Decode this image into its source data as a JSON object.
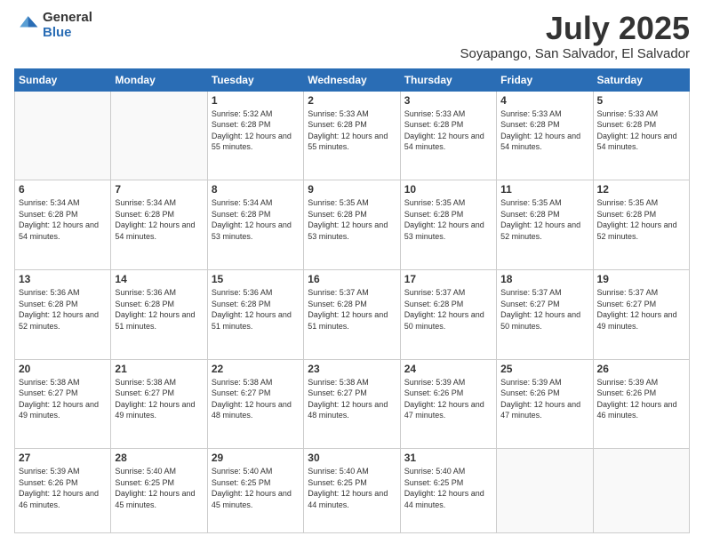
{
  "logo": {
    "general": "General",
    "blue": "Blue"
  },
  "header": {
    "month": "July 2025",
    "location": "Soyapango, San Salvador, El Salvador"
  },
  "weekdays": [
    "Sunday",
    "Monday",
    "Tuesday",
    "Wednesday",
    "Thursday",
    "Friday",
    "Saturday"
  ],
  "weeks": [
    [
      {
        "day": "",
        "info": ""
      },
      {
        "day": "",
        "info": ""
      },
      {
        "day": "1",
        "info": "Sunrise: 5:32 AM\nSunset: 6:28 PM\nDaylight: 12 hours and 55 minutes."
      },
      {
        "day": "2",
        "info": "Sunrise: 5:33 AM\nSunset: 6:28 PM\nDaylight: 12 hours and 55 minutes."
      },
      {
        "day": "3",
        "info": "Sunrise: 5:33 AM\nSunset: 6:28 PM\nDaylight: 12 hours and 54 minutes."
      },
      {
        "day": "4",
        "info": "Sunrise: 5:33 AM\nSunset: 6:28 PM\nDaylight: 12 hours and 54 minutes."
      },
      {
        "day": "5",
        "info": "Sunrise: 5:33 AM\nSunset: 6:28 PM\nDaylight: 12 hours and 54 minutes."
      }
    ],
    [
      {
        "day": "6",
        "info": "Sunrise: 5:34 AM\nSunset: 6:28 PM\nDaylight: 12 hours and 54 minutes."
      },
      {
        "day": "7",
        "info": "Sunrise: 5:34 AM\nSunset: 6:28 PM\nDaylight: 12 hours and 54 minutes."
      },
      {
        "day": "8",
        "info": "Sunrise: 5:34 AM\nSunset: 6:28 PM\nDaylight: 12 hours and 53 minutes."
      },
      {
        "day": "9",
        "info": "Sunrise: 5:35 AM\nSunset: 6:28 PM\nDaylight: 12 hours and 53 minutes."
      },
      {
        "day": "10",
        "info": "Sunrise: 5:35 AM\nSunset: 6:28 PM\nDaylight: 12 hours and 53 minutes."
      },
      {
        "day": "11",
        "info": "Sunrise: 5:35 AM\nSunset: 6:28 PM\nDaylight: 12 hours and 52 minutes."
      },
      {
        "day": "12",
        "info": "Sunrise: 5:35 AM\nSunset: 6:28 PM\nDaylight: 12 hours and 52 minutes."
      }
    ],
    [
      {
        "day": "13",
        "info": "Sunrise: 5:36 AM\nSunset: 6:28 PM\nDaylight: 12 hours and 52 minutes."
      },
      {
        "day": "14",
        "info": "Sunrise: 5:36 AM\nSunset: 6:28 PM\nDaylight: 12 hours and 51 minutes."
      },
      {
        "day": "15",
        "info": "Sunrise: 5:36 AM\nSunset: 6:28 PM\nDaylight: 12 hours and 51 minutes."
      },
      {
        "day": "16",
        "info": "Sunrise: 5:37 AM\nSunset: 6:28 PM\nDaylight: 12 hours and 51 minutes."
      },
      {
        "day": "17",
        "info": "Sunrise: 5:37 AM\nSunset: 6:28 PM\nDaylight: 12 hours and 50 minutes."
      },
      {
        "day": "18",
        "info": "Sunrise: 5:37 AM\nSunset: 6:27 PM\nDaylight: 12 hours and 50 minutes."
      },
      {
        "day": "19",
        "info": "Sunrise: 5:37 AM\nSunset: 6:27 PM\nDaylight: 12 hours and 49 minutes."
      }
    ],
    [
      {
        "day": "20",
        "info": "Sunrise: 5:38 AM\nSunset: 6:27 PM\nDaylight: 12 hours and 49 minutes."
      },
      {
        "day": "21",
        "info": "Sunrise: 5:38 AM\nSunset: 6:27 PM\nDaylight: 12 hours and 49 minutes."
      },
      {
        "day": "22",
        "info": "Sunrise: 5:38 AM\nSunset: 6:27 PM\nDaylight: 12 hours and 48 minutes."
      },
      {
        "day": "23",
        "info": "Sunrise: 5:38 AM\nSunset: 6:27 PM\nDaylight: 12 hours and 48 minutes."
      },
      {
        "day": "24",
        "info": "Sunrise: 5:39 AM\nSunset: 6:26 PM\nDaylight: 12 hours and 47 minutes."
      },
      {
        "day": "25",
        "info": "Sunrise: 5:39 AM\nSunset: 6:26 PM\nDaylight: 12 hours and 47 minutes."
      },
      {
        "day": "26",
        "info": "Sunrise: 5:39 AM\nSunset: 6:26 PM\nDaylight: 12 hours and 46 minutes."
      }
    ],
    [
      {
        "day": "27",
        "info": "Sunrise: 5:39 AM\nSunset: 6:26 PM\nDaylight: 12 hours and 46 minutes."
      },
      {
        "day": "28",
        "info": "Sunrise: 5:40 AM\nSunset: 6:25 PM\nDaylight: 12 hours and 45 minutes."
      },
      {
        "day": "29",
        "info": "Sunrise: 5:40 AM\nSunset: 6:25 PM\nDaylight: 12 hours and 45 minutes."
      },
      {
        "day": "30",
        "info": "Sunrise: 5:40 AM\nSunset: 6:25 PM\nDaylight: 12 hours and 44 minutes."
      },
      {
        "day": "31",
        "info": "Sunrise: 5:40 AM\nSunset: 6:25 PM\nDaylight: 12 hours and 44 minutes."
      },
      {
        "day": "",
        "info": ""
      },
      {
        "day": "",
        "info": ""
      }
    ]
  ]
}
